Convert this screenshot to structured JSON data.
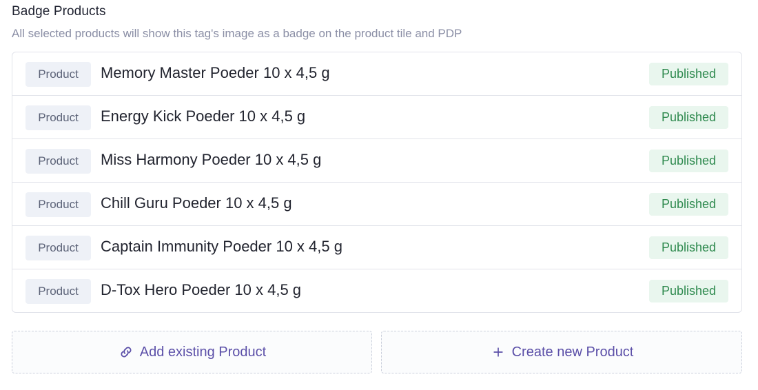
{
  "section": {
    "title": "Badge Products",
    "subtitle": "All selected products will show this tag's image as a badge on the product tile and PDP"
  },
  "products": [
    {
      "type": "Product",
      "name": "Memory Master Poeder 10 x 4,5 g",
      "status": "Published"
    },
    {
      "type": "Product",
      "name": "Energy Kick Poeder 10 x 4,5 g",
      "status": "Published"
    },
    {
      "type": "Product",
      "name": "Miss Harmony Poeder 10 x 4,5 g",
      "status": "Published"
    },
    {
      "type": "Product",
      "name": "Chill Guru Poeder 10 x 4,5 g",
      "status": "Published"
    },
    {
      "type": "Product",
      "name": "Captain Immunity Poeder 10 x 4,5 g",
      "status": "Published"
    },
    {
      "type": "Product",
      "name": "D-Tox Hero Poeder 10 x 4,5 g",
      "status": "Published"
    }
  ],
  "actions": {
    "add_existing": {
      "label": "Add existing Product",
      "icon": "link-icon"
    },
    "create_new": {
      "label": "Create new Product",
      "icon": "plus-icon"
    }
  },
  "colors": {
    "accent": "#5b4fa8",
    "published_text": "#2f8a4f",
    "published_bg": "#e9f6ee",
    "type_badge_bg": "#eef1f7"
  }
}
